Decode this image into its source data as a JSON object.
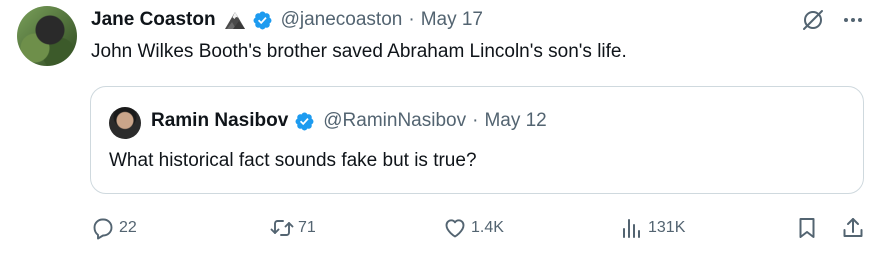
{
  "tweet": {
    "author_name": "Jane Coaston",
    "handle": "@janecoaston",
    "separator": "·",
    "date": "May 17",
    "text": "John Wilkes Booth's brother saved Abraham Lincoln's son's life."
  },
  "quoted": {
    "author_name": "Ramin Nasibov",
    "handle": "@RaminNasibov",
    "separator": "·",
    "date": "May 12",
    "text": "What historical fact sounds fake but is true?"
  },
  "actions": {
    "replies": "22",
    "reposts": "71",
    "likes": "1.4K",
    "views": "131K"
  },
  "icons": {
    "reply": "reply-icon",
    "repost": "repost-icon",
    "like": "heart-icon",
    "views": "views-icon",
    "bookmark": "bookmark-icon",
    "share": "share-icon",
    "grok": "grok-icon",
    "more": "more-icon",
    "verified": "verified-badge-icon",
    "emoji": "mountain-emoji-icon"
  },
  "colors": {
    "verified": "#1d9bf0",
    "secondary_text": "#536471",
    "primary_text": "#0f1419",
    "border": "#cfd9de"
  }
}
